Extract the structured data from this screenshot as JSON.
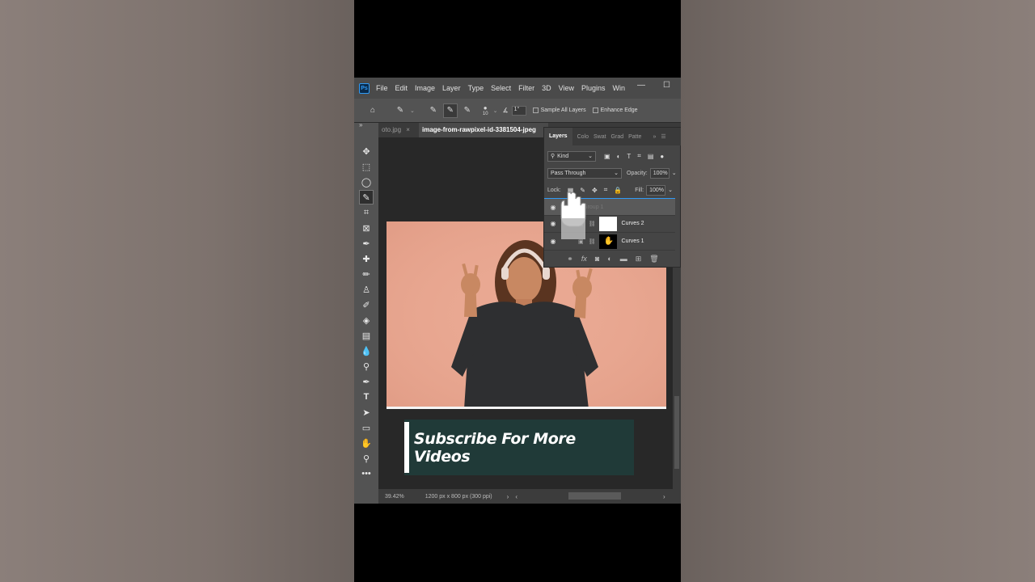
{
  "menu": {
    "logo": "Ps",
    "items": [
      "File",
      "Edit",
      "Image",
      "Layer",
      "Type",
      "Select",
      "Filter",
      "3D",
      "View",
      "Plugins",
      "Win"
    ]
  },
  "options": {
    "brush_size": "10",
    "angle": "1°",
    "sample_all_layers": "Sample All Layers",
    "enhance_edge": "Enhance Edge"
  },
  "tabs": {
    "inactive": "oto.jpg",
    "active": "image-from-rawpixel-id-3381504-jpeg"
  },
  "layers_panel": {
    "tabs": [
      "Layers",
      "Colo",
      "Swat",
      "Grad",
      "Patte"
    ],
    "kind_label": "Kind",
    "blend_mode": "Pass Through",
    "opacity_label": "Opacity:",
    "opacity_value": "100%",
    "lock_label": "Lock:",
    "fill_label": "Fill:",
    "fill_value": "100%",
    "layers": [
      {
        "name": "Group 1"
      },
      {
        "name": "Curves 2"
      },
      {
        "name": "Curves 1"
      }
    ]
  },
  "status": {
    "zoom": "39.42%",
    "doc_info": "1200 px x 800 px (300 ppi)"
  },
  "banner": {
    "text": "Subscribe For More Videos"
  },
  "colors": {
    "foreground": "#1ed91e",
    "background": "#ffffff",
    "accent": "#2f9bf7"
  }
}
